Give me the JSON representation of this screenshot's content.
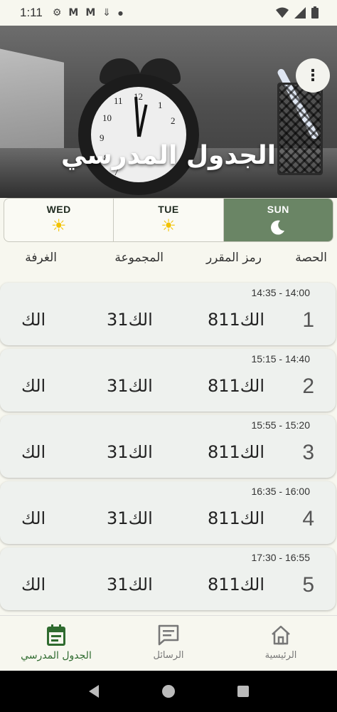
{
  "status_bar": {
    "time": "1:11",
    "left_icons": [
      "gear-icon",
      "gmail-icon",
      "gmail-icon",
      "download-icon",
      "dot-icon"
    ],
    "right_icons": [
      "wifi-icon",
      "signal-icon",
      "battery-icon"
    ]
  },
  "header": {
    "title": "الجدول المدرسي",
    "menu_icon": "more-vertical-icon"
  },
  "day_tabs": [
    {
      "label": "WED",
      "icon": "sun-icon",
      "active": false
    },
    {
      "label": "TUE",
      "icon": "sun-icon",
      "active": false
    },
    {
      "label": "SUN",
      "icon": "moon-icon",
      "active": true
    }
  ],
  "columns": {
    "period": "الحصة",
    "course_code": "رمز المقرر",
    "group": "المجموعة",
    "room": "الغرفة"
  },
  "rows": [
    {
      "time": "14:35 - 14:00",
      "period": "1",
      "code": "الك811",
      "group": "3الك1",
      "room": "الك"
    },
    {
      "time": "15:15 - 14:40",
      "period": "2",
      "code": "الك811",
      "group": "3الك1",
      "room": "الك"
    },
    {
      "time": "15:55 - 15:20",
      "period": "3",
      "code": "الك811",
      "group": "3الك1",
      "room": "الك"
    },
    {
      "time": "16:35 - 16:00",
      "period": "4",
      "code": "الك811",
      "group": "3الك1",
      "room": "الك"
    },
    {
      "time": "17:30 - 16:55",
      "period": "5",
      "code": "الك811",
      "group": "3الك1",
      "room": "الك"
    }
  ],
  "bottom_nav": [
    {
      "label": "الجدول المدرسي",
      "icon": "calendar-icon",
      "active": true
    },
    {
      "label": "الرسائل",
      "icon": "chat-icon",
      "active": false
    },
    {
      "label": "الرئيسية",
      "icon": "home-icon",
      "active": false
    }
  ],
  "colors": {
    "accent": "#6a8565",
    "background": "#f7f7ef",
    "row_bg": "#eef1ee",
    "active_nav": "#2f6b2f",
    "sun": "#f2c200"
  }
}
